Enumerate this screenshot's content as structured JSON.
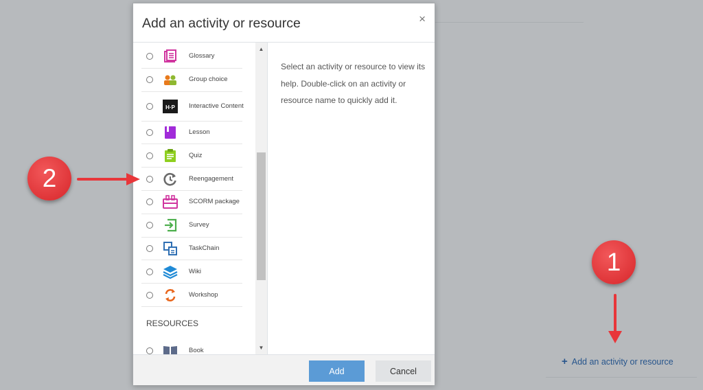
{
  "modal": {
    "title": "Add an activity or resource",
    "close_glyph": "×",
    "help_text": "Select an activity or resource to view its help. Double-click on an activity or resource name to quickly add it.",
    "activities": [
      {
        "label": "Glossary",
        "icon": "glossary-icon",
        "color": "#d0359f"
      },
      {
        "label": "Group choice",
        "icon": "group-choice-icon",
        "color": "#e87a1c"
      },
      {
        "label": "Interactive Content",
        "icon": "h5p-icon",
        "color": "#1a1a1a"
      },
      {
        "label": "Lesson",
        "icon": "lesson-icon",
        "color": "#a12bd9"
      },
      {
        "label": "Quiz",
        "icon": "quiz-icon",
        "color": "#8fcf1f"
      },
      {
        "label": "Reengagement",
        "icon": "reengagement-icon",
        "color": "#6b6b6b"
      },
      {
        "label": "SCORM package",
        "icon": "scorm-icon",
        "color": "#d0359f"
      },
      {
        "label": "Survey",
        "icon": "survey-icon",
        "color": "#4cae4c"
      },
      {
        "label": "TaskChain",
        "icon": "taskchain-icon",
        "color": "#2f6fb3"
      },
      {
        "label": "Wiki",
        "icon": "wiki-icon",
        "color": "#1f8ad6"
      },
      {
        "label": "Workshop",
        "icon": "workshop-icon",
        "color": "#e8661c"
      }
    ],
    "resources_heading": "RESOURCES",
    "resources": [
      {
        "label": "Book",
        "icon": "book-icon",
        "color": "#5d6b8a"
      }
    ],
    "add_label": "Add",
    "cancel_label": "Cancel"
  },
  "background": {
    "add_link_label": "Add an activity or resource",
    "add_link_plus": "+"
  },
  "callouts": {
    "step1": "1",
    "step2": "2",
    "color": "#e8363a"
  }
}
